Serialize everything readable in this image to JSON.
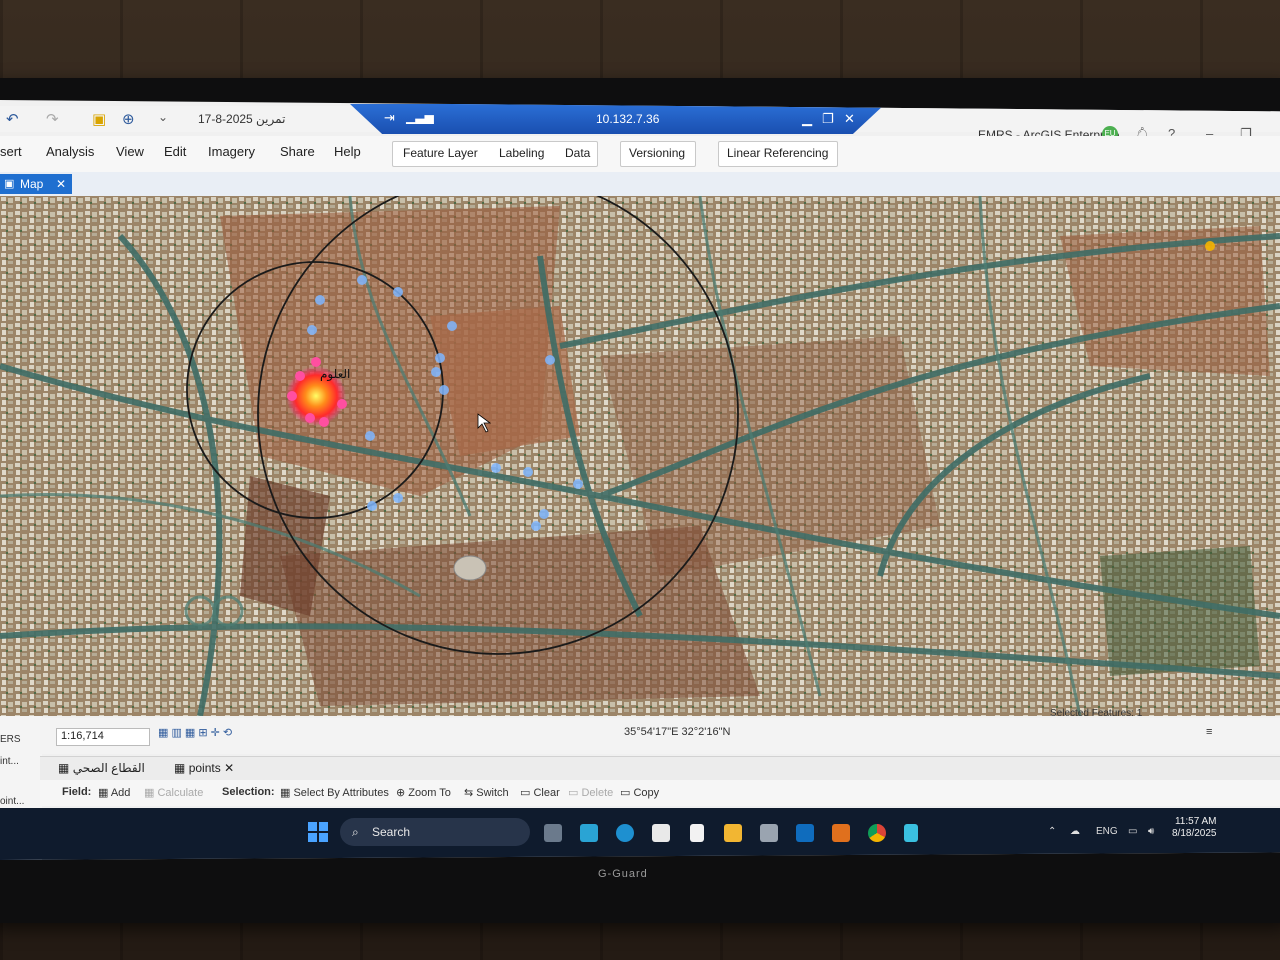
{
  "quick_access": {
    "date_label": "17-8-2025 تمرين"
  },
  "remote_session": {
    "address": "10.132.7.36"
  },
  "portal": {
    "name": "EMRS - ArcGIS Enterprise",
    "badge": "EU"
  },
  "ribbon": {
    "tabs": [
      "sert",
      "Analysis",
      "View",
      "Edit",
      "Imagery",
      "Share",
      "Help"
    ],
    "contextual": {
      "feature_layer": "Feature Layer",
      "labeling": "Labeling",
      "data": "Data",
      "versioning": "Versioning",
      "linear_referencing": "Linear Referencing"
    }
  },
  "doc_tab": {
    "label": "Map",
    "close": "✕"
  },
  "map": {
    "label_arabic": "العلوم"
  },
  "status": {
    "scale": "1:16,714",
    "coordinates": "35°54'17\"E 32°2'16\"N",
    "selected_features": "Selected Features: 1"
  },
  "attribute_table": {
    "tab1": "القطاع الصحي",
    "tab2": "points",
    "field_label": "Field:",
    "add": "Add",
    "calculate": "Calculate",
    "selection_label": "Selection:",
    "select_by_attributes": "Select By Attributes",
    "zoom_to": "Zoom To",
    "switch": "Switch",
    "clear": "Clear",
    "delete": "Delete",
    "copy": "Copy"
  },
  "left_pane": {
    "labels": [
      "ERS",
      "int...",
      "oint..."
    ]
  },
  "taskbar": {
    "search": "Search",
    "language": "ENG",
    "time": "11:57 AM",
    "date": "8/18/2025"
  },
  "device": {
    "brand": "G-Guard"
  },
  "colors": {
    "accent": "#1f6fd0",
    "rdp_bar": "#2b6fd6",
    "taskbar": "#0f1b2d",
    "hotspot": "#ff2a2a"
  }
}
